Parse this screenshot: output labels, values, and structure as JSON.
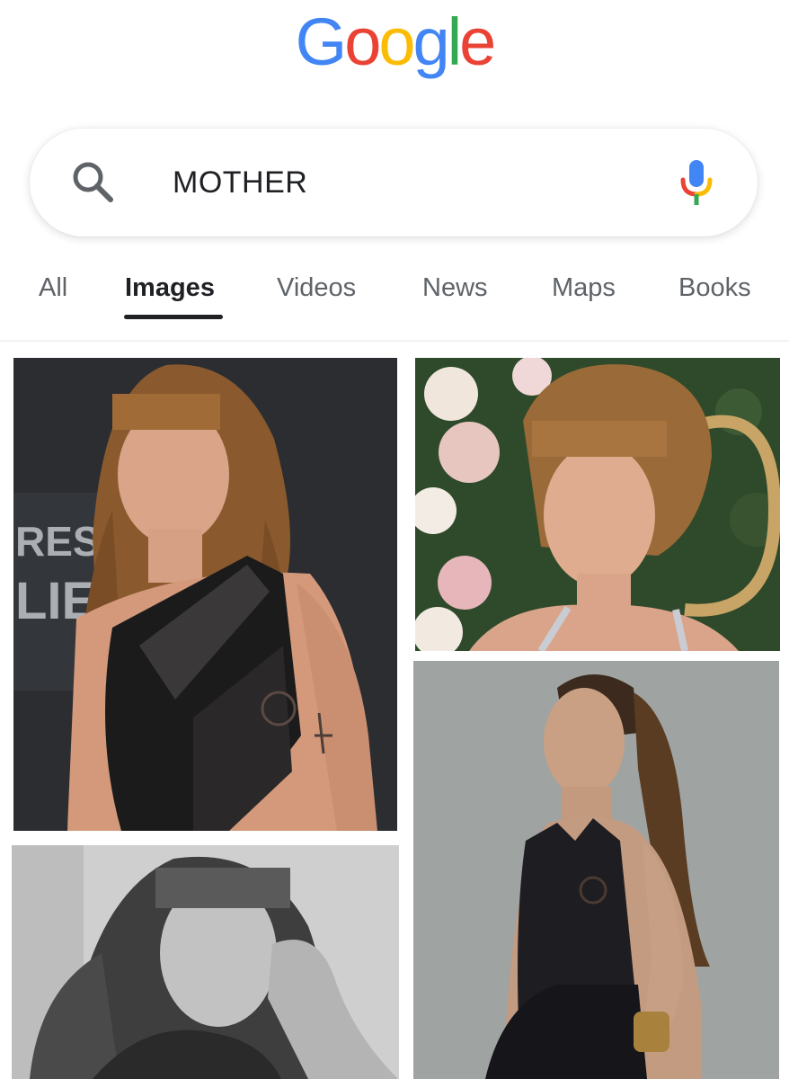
{
  "logo": {
    "letters": [
      "G",
      "o",
      "o",
      "g",
      "l",
      "e"
    ],
    "colors": [
      "#4285F4",
      "#EA4335",
      "#FBBC05",
      "#4285F4",
      "#34A853",
      "#EA4335"
    ]
  },
  "search": {
    "query": "MOTHER",
    "icon": "search-icon",
    "mic_icon": "mic-icon"
  },
  "tabs": [
    {
      "label": "All",
      "active": false
    },
    {
      "label": "Images",
      "active": true
    },
    {
      "label": "Videos",
      "active": false
    },
    {
      "label": "News",
      "active": false
    },
    {
      "label": "Maps",
      "active": false
    },
    {
      "label": "Books",
      "active": false
    }
  ],
  "results": [
    {
      "id": "result-1",
      "kind": "photo-red-carpet-black-halter"
    },
    {
      "id": "result-2",
      "kind": "photo-floral-backdrop-updo"
    },
    {
      "id": "result-3",
      "kind": "photo-black-and-white-portrait"
    },
    {
      "id": "result-4",
      "kind": "photo-grey-studio-ponytail"
    }
  ],
  "colors": {
    "accent_text": "#202124",
    "muted_text": "#5f6368"
  }
}
